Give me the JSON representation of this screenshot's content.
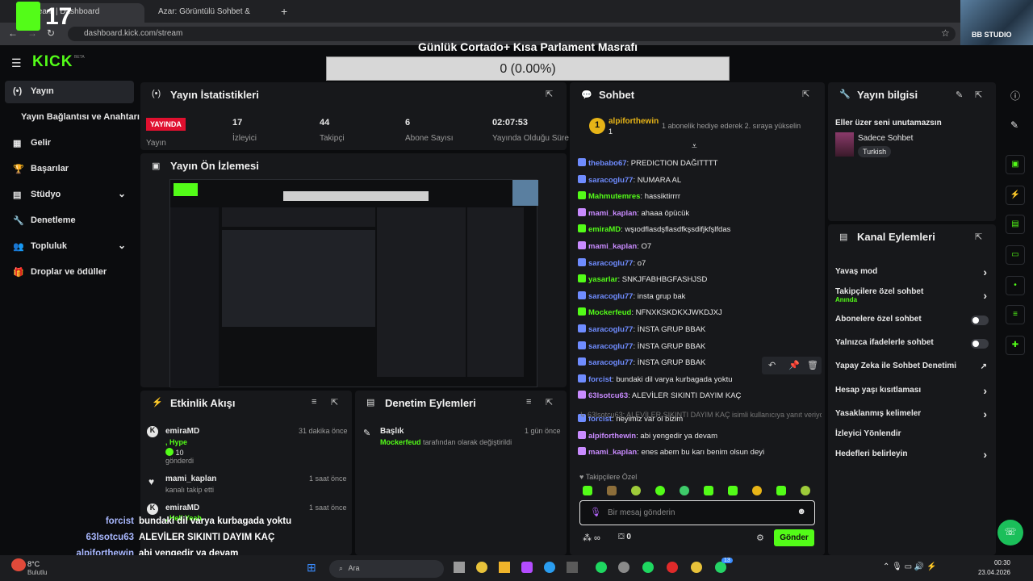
{
  "browser": {
    "tabs": [
      "Stream | Dashboard",
      "Azar: Görüntülü Sohbet &",
      ""
    ],
    "url": "dashboard.kick.com/stream",
    "new_tab": "+"
  },
  "overlay": {
    "logo_number": "17",
    "cost_title": "Günlük Cortado+ Kısa Parlament Masrafı",
    "cost_value": "0 (0.00%)",
    "left_count": "0",
    "right_count": "1",
    "corner_logo": "BB STUDIO"
  },
  "sidebar": {
    "logo": "KICK",
    "logo_beta": "BETA",
    "items": [
      {
        "label": "Yayın",
        "icon": "(•)"
      },
      {
        "label": "Yayın Bağlantısı ve Anahtarı",
        "icon": ""
      },
      {
        "label": "Gelir",
        "icon": "▦"
      },
      {
        "label": "Başarılar",
        "icon": "🏆"
      },
      {
        "label": "Stüdyo",
        "icon": "▤"
      },
      {
        "label": "Denetleme",
        "icon": "🔧"
      },
      {
        "label": "Topluluk",
        "icon": "👥"
      },
      {
        "label": "Droplar ve ödüller",
        "icon": "🎁"
      }
    ]
  },
  "stats": {
    "title": "Yayın İstatistikleri",
    "live_badge": "YAYINDA",
    "live_label": "Yayın",
    "items": [
      {
        "value": "17",
        "label": "İzleyici"
      },
      {
        "value": "44",
        "label": "Takipçi"
      },
      {
        "value": "6",
        "label": "Abone Sayısı"
      },
      {
        "value": "02:07:53",
        "label": "Yayında Olduğu Süre"
      }
    ]
  },
  "preview": {
    "title": "Yayın Ön İzlemesi"
  },
  "activity": {
    "title": "Etkinlik Akışı",
    "items": [
      {
        "user": "emiraMD",
        "line1": ", Hype",
        "amount": "10",
        "line2": "gönderdi",
        "time": "31 dakika önce"
      },
      {
        "user": "mami_kaplan",
        "line1": "kanalı takip etti",
        "time": "1 saat önce"
      },
      {
        "user": "emiraMD",
        "line1": ", Hell Yeah",
        "time": "1 saat önce"
      }
    ]
  },
  "moderation": {
    "title": "Denetim Eylemleri",
    "item": {
      "heading": "Başlık",
      "user": "Mockerfeud",
      "text1": "tarafından",
      "text2": "olarak değiştirildi",
      "time": "1 gün önce"
    }
  },
  "chat": {
    "title": "Sohbet",
    "pinned_user": "alpiforthewin",
    "pinned_rank": "1",
    "pinned_note": "1 abonelik hediye ederek 2. sıraya yükselin",
    "messages": [
      {
        "user": "thebabo67",
        "text": "PREDICTION DAĞITTTT",
        "color": "#6f8cff"
      },
      {
        "user": "saracoglu77",
        "text": "NUMARA AL",
        "color": "#6f8cff"
      },
      {
        "user": "Mahmutemres",
        "text": "hassiktirrrr",
        "color": "#53fc18"
      },
      {
        "user": "mami_kaplan",
        "text": "ahaaa öpücük",
        "color": "#c98bff"
      },
      {
        "user": "emiraMD",
        "text": "wşıodflasdşflasdfkşsdifjkfşlfdas",
        "color": "#53fc18"
      },
      {
        "user": "mami_kaplan",
        "text": "O7",
        "color": "#c98bff"
      },
      {
        "user": "saracoglu77",
        "text": "o7",
        "color": "#6f8cff"
      },
      {
        "user": "yasarlar",
        "text": "SNKJFABHBGFASHJSD",
        "color": "#53fc18"
      },
      {
        "user": "saracoglu77",
        "text": "insta grup bak",
        "color": "#6f8cff"
      },
      {
        "user": "Mockerfeud",
        "text": "NFNXKSKDKXJWKDJXJ",
        "color": "#53fc18"
      },
      {
        "user": "saracoglu77",
        "text": "İNSTA GRUP BBAK",
        "color": "#6f8cff"
      },
      {
        "user": "saracoglu77",
        "text": "İNSTA GRUP BBAK",
        "color": "#6f8cff"
      },
      {
        "user": "saracoglu77",
        "text": "İNSTA GRUP BBAK",
        "color": "#6f8cff"
      },
      {
        "user": "forcist",
        "text": "bundaki dil varya kurbagada yoktu",
        "color": "#6f8cff"
      },
      {
        "user": "63lsotcu63",
        "text": "ALEVİLER SIKINTI DAYIM KAÇ",
        "color": "#c98bff"
      },
      {
        "user": "forcist",
        "text": "neyimiz var ol bizim",
        "color": "#6f8cff"
      },
      {
        "user": "alpiforthewin",
        "text": "abi yengedir ya devam",
        "color": "#c98bff"
      },
      {
        "user": "mami_kaplan",
        "text": "enes abem bu karı benim olsun deyi",
        "color": "#c98bff"
      }
    ],
    "reply_note": "63lsotcu63: ALEVİLER SIKINTI DAYIM KAÇ isimli kullanıcıya yanıt veriyor",
    "followers_only": "Takipçilere Özel",
    "input_placeholder": "Bir mesaj gönderin",
    "points": "0",
    "send_label": "Gönder"
  },
  "stream_info": {
    "title": "Yayın bilgisi",
    "stream_title": "Eller üzer seni unutamazsın",
    "category": "Sadece Sohbet",
    "language": "Turkish"
  },
  "channel_actions": {
    "title": "Kanal Eylemleri",
    "items": [
      {
        "label": "Yavaş mod",
        "type": "chevron"
      },
      {
        "label": "Takipçilere özel sohbet",
        "sub": "Anında",
        "type": "chevron"
      },
      {
        "label": "Abonelere özel sohbet",
        "type": "toggle"
      },
      {
        "label": "Yalnızca ifadelerle sohbet",
        "type": "toggle"
      },
      {
        "label": "Yapay Zeka ile Sohbet Denetimi",
        "type": "external"
      },
      {
        "label": "Hesap yaşı kısıtlaması",
        "type": "chevron"
      },
      {
        "label": "Yasaklanmış kelimeler",
        "type": "chevron"
      },
      {
        "label": "İzleyici Yönlendir",
        "type": "none"
      },
      {
        "label": "Hedefleri belirleyin",
        "type": "chevron"
      }
    ]
  },
  "overlay_chat": [
    {
      "user": "forcist",
      "text": "bundaki dil varya kurbagada yoktu"
    },
    {
      "user": "63lsotcu63",
      "text": "ALEVİLER SIKINTI DAYIM KAÇ"
    },
    {
      "user": "alpiforthewin",
      "text": "abi yengedir ya devam"
    },
    {
      "user": "mami_kaplan",
      "text": "enes abem bu karı benim olsun deyi"
    }
  ],
  "taskbar": {
    "weather_temp": "8°C",
    "weather_desc": "Bulutlu",
    "search_placeholder": "Ara",
    "time": "00:30",
    "date": "23.04.2026",
    "badge": "13"
  },
  "colors": {
    "accent": "#53fc18",
    "live": "#e0102f",
    "panel": "#17181b"
  }
}
